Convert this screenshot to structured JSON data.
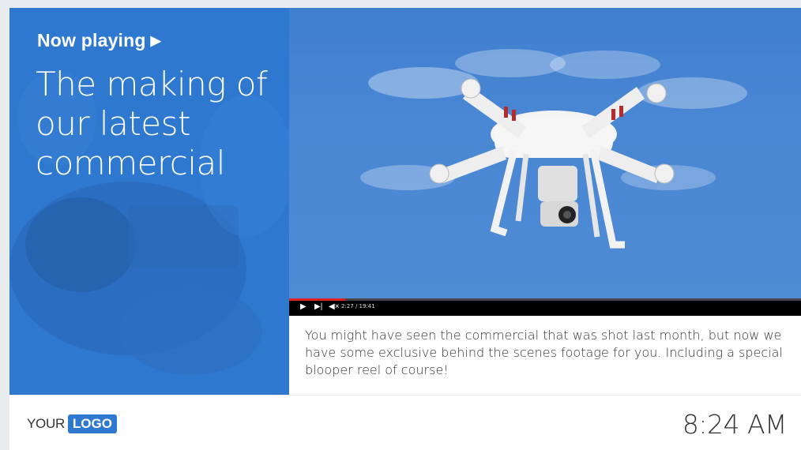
{
  "now_playing": {
    "label": "Now playing",
    "indicator": "▶"
  },
  "video": {
    "title": "The making of our latest commercial",
    "time": "2:27 / 19:41",
    "progress": 0.11,
    "description": "You might have seen the commercial that was shot last month, but now we have some exclusive behind the scenes footage for you. Including a special blooper reel of course!",
    "icons": [
      "play-icon",
      "skip-next-icon",
      "mute-icon"
    ]
  },
  "footer": {
    "logo_prefix": "YOUR",
    "logo_word": "LOGO",
    "clock": "8:24 AM"
  },
  "colors": {
    "accent": "#2f78d0",
    "progress": "#e02020"
  }
}
